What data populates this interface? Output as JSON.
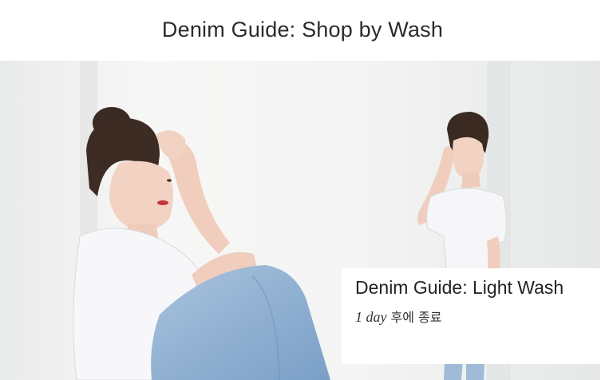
{
  "header": {
    "title": "Denim Guide: Shop by Wash"
  },
  "card": {
    "title": "Denim Guide: Light Wash",
    "countdown": "1 day",
    "countdown_suffix": "후에 종료"
  }
}
